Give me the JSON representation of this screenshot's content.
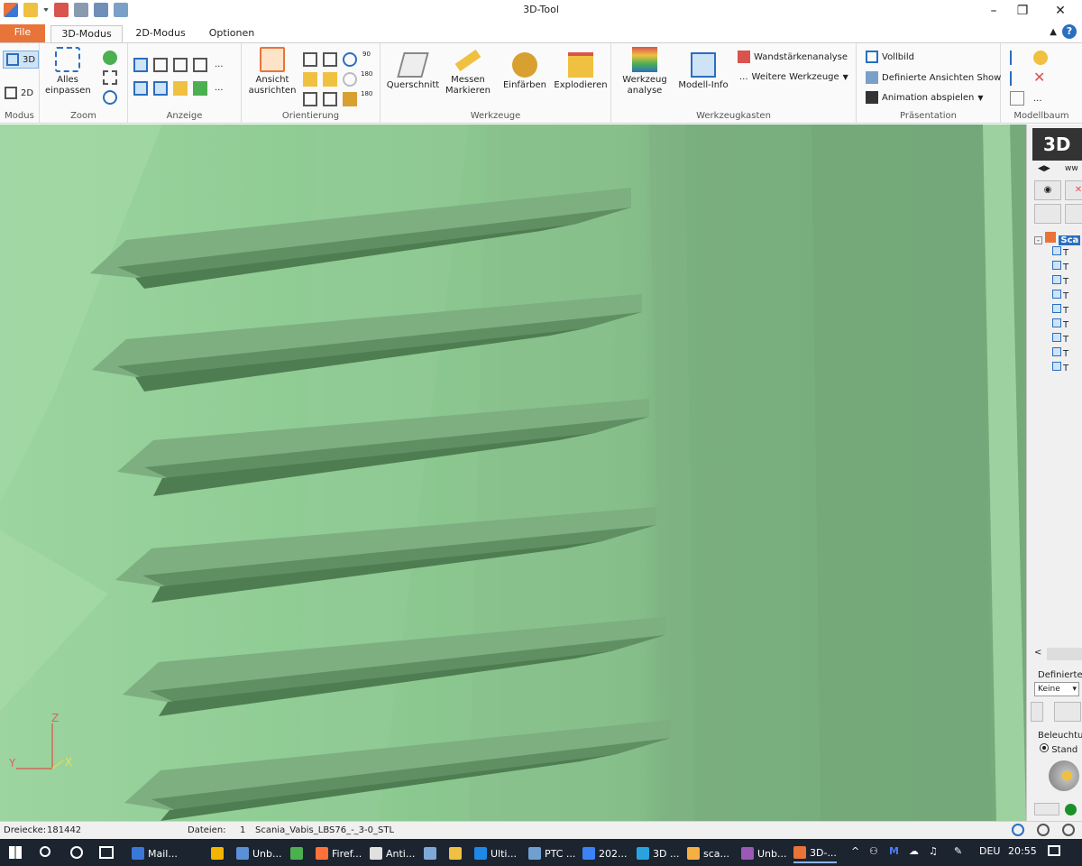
{
  "window": {
    "title": "3D-Tool"
  },
  "ribbon": {
    "tabs": [
      {
        "label": "File"
      },
      {
        "label": "3D-Modus"
      },
      {
        "label": "2D-Modus"
      },
      {
        "label": "Optionen"
      }
    ],
    "groups": {
      "modus": {
        "label": "Modus",
        "btn3d": "3D",
        "btn2d": "2D"
      },
      "zoom": {
        "label": "Zoom",
        "fit_all": "Alles einpassen"
      },
      "anzeige": {
        "label": "Anzeige",
        "more1": "...",
        "more2": "..."
      },
      "orientierung": {
        "label": "Orientierung",
        "align_view": "Ansicht ausrichten",
        "r90": "90",
        "r180a": "180",
        "r180b": "180"
      },
      "werkzeuge": {
        "label": "Werkzeuge",
        "querschnitt": "Querschnitt",
        "messen": "Messen Markieren",
        "einfaerben": "Einfärben",
        "explodieren": "Explodieren"
      },
      "werkzeugkasten": {
        "label": "Werkzeugkasten",
        "werkzeug_analyse": "Werkzeug analyse",
        "modell_info": "Modell-Info",
        "wandstaerke": "Wandstärkenanalyse",
        "weitere": "Weitere Werkzeuge"
      },
      "praesentation": {
        "label": "Präsentation",
        "vollbild": "Vollbild",
        "definierte_show": "Definierte Ansichten Show",
        "animation": "Animation abspielen"
      },
      "modellbaum": {
        "label": "Modellbaum",
        "more": "..."
      }
    }
  },
  "viewport": {
    "axes": {
      "z": "Z",
      "y": "Y",
      "x": "X"
    }
  },
  "rightpanel": {
    "logo": "3D",
    "url_fragment": "ww",
    "tree_root": "Sca",
    "tree_children": [
      "T",
      "T",
      "T",
      "T",
      "T",
      "T",
      "T",
      "T",
      "T"
    ],
    "definierte_label": "Definierte",
    "definierte_select": "Keine",
    "beleuchtung_label": "Beleuchtur",
    "beleuchtung_option": "Stand"
  },
  "statusbar": {
    "triangles_label": "Dreiecke:",
    "triangles_value": "181442",
    "files_label": "Dateien:",
    "files_count": "1",
    "file_name": "Scania_Vabis_LBS76_-_3-0_STL"
  },
  "taskbar": {
    "apps": [
      {
        "label": "Mail...",
        "color": "#3a78d8"
      },
      {
        "label": "",
        "color": "#f4b400"
      },
      {
        "label": "Unb...",
        "color": "#5b8fd6"
      },
      {
        "label": "",
        "color": "#4caf50"
      },
      {
        "label": "Firef...",
        "color": "#ff7139"
      },
      {
        "label": "Anti...",
        "color": "#e0e0e0"
      },
      {
        "label": "",
        "color": "#7fa8d8"
      },
      {
        "label": "",
        "color": "#f0c040"
      },
      {
        "label": "Ulti...",
        "color": "#1e88e5"
      },
      {
        "label": "PTC ...",
        "color": "#6fa0d0"
      },
      {
        "label": "202...",
        "color": "#3b82f6"
      },
      {
        "label": "3D ...",
        "color": "#29a3e0"
      },
      {
        "label": "sca...",
        "color": "#f5b041"
      },
      {
        "label": "Unb...",
        "color": "#9b59b6"
      },
      {
        "label": "3D-...",
        "color": "#e8743a"
      }
    ],
    "lang": "DEU",
    "time": "20:55"
  }
}
